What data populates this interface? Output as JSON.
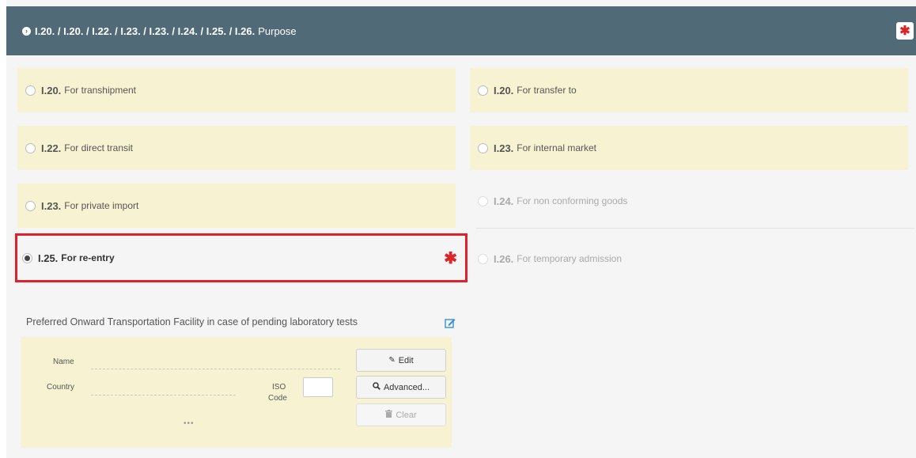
{
  "header": {
    "codes": "I.20. / I.20. / I.22. / I.23. / I.23. / I.24. / I.25. / I.26.",
    "title": "Purpose",
    "required_mark": "✱"
  },
  "options": {
    "transhipment": {
      "code": "I.20.",
      "label": "For transhipment"
    },
    "transfer": {
      "code": "I.20.",
      "label": "For transfer to"
    },
    "direct_transit": {
      "code": "I.22.",
      "label": "For direct transit"
    },
    "internal_market": {
      "code": "I.23.",
      "label": "For internal market"
    },
    "private_import": {
      "code": "I.23.",
      "label": "For private import"
    },
    "non_conforming": {
      "code": "I.24.",
      "label": "For non conforming goods"
    },
    "reentry": {
      "code": "I.25.",
      "label": "For re-entry",
      "required_mark": "✱",
      "selected": true
    },
    "temporary_admission": {
      "code": "I.26.",
      "label": "For temporary admission"
    }
  },
  "facility": {
    "title": "Preferred Onward Transportation Facility in case of pending laboratory tests",
    "name_label": "Name",
    "country_label": "Country",
    "iso_label_1": "ISO",
    "iso_label_2": "Code",
    "edit_label": "Edit",
    "advanced_label": "Advanced...",
    "clear_label": "Clear",
    "more": "•••"
  },
  "colors": {
    "header_bg": "#516a78",
    "option_bg": "#f7f3d2",
    "highlight": "#e3202a",
    "required": "#d9262b"
  }
}
